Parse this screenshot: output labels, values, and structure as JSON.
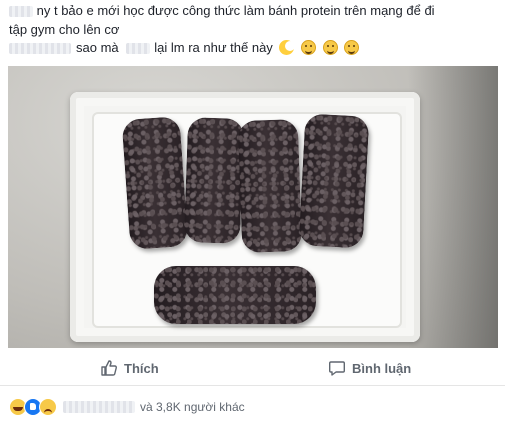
{
  "post": {
    "line1_text": "ny t bảo e mới học được công thức làm bánh protein trên mạng để đi",
    "line2_text": "tập gym cho lên cơ",
    "line3_text_a": "sao mà",
    "line3_text_b": "lại lm ra như thế này"
  },
  "actions": {
    "like_label": "Thích",
    "comment_label": "Bình luận"
  },
  "reactions": {
    "others_text": "và 3,8K người khác"
  },
  "icons": [
    "moon-emoji-icon",
    "smile-emoji-icon",
    "laugh-emoji-icon",
    "sweat-emoji-icon",
    "thumbs-up-icon",
    "comment-bubble-icon",
    "haha-reaction-icon",
    "like-reaction-icon",
    "sad-reaction-icon"
  ],
  "colors": {
    "text": "#1d2129",
    "muted": "#606770",
    "accent": "#1877f2"
  }
}
